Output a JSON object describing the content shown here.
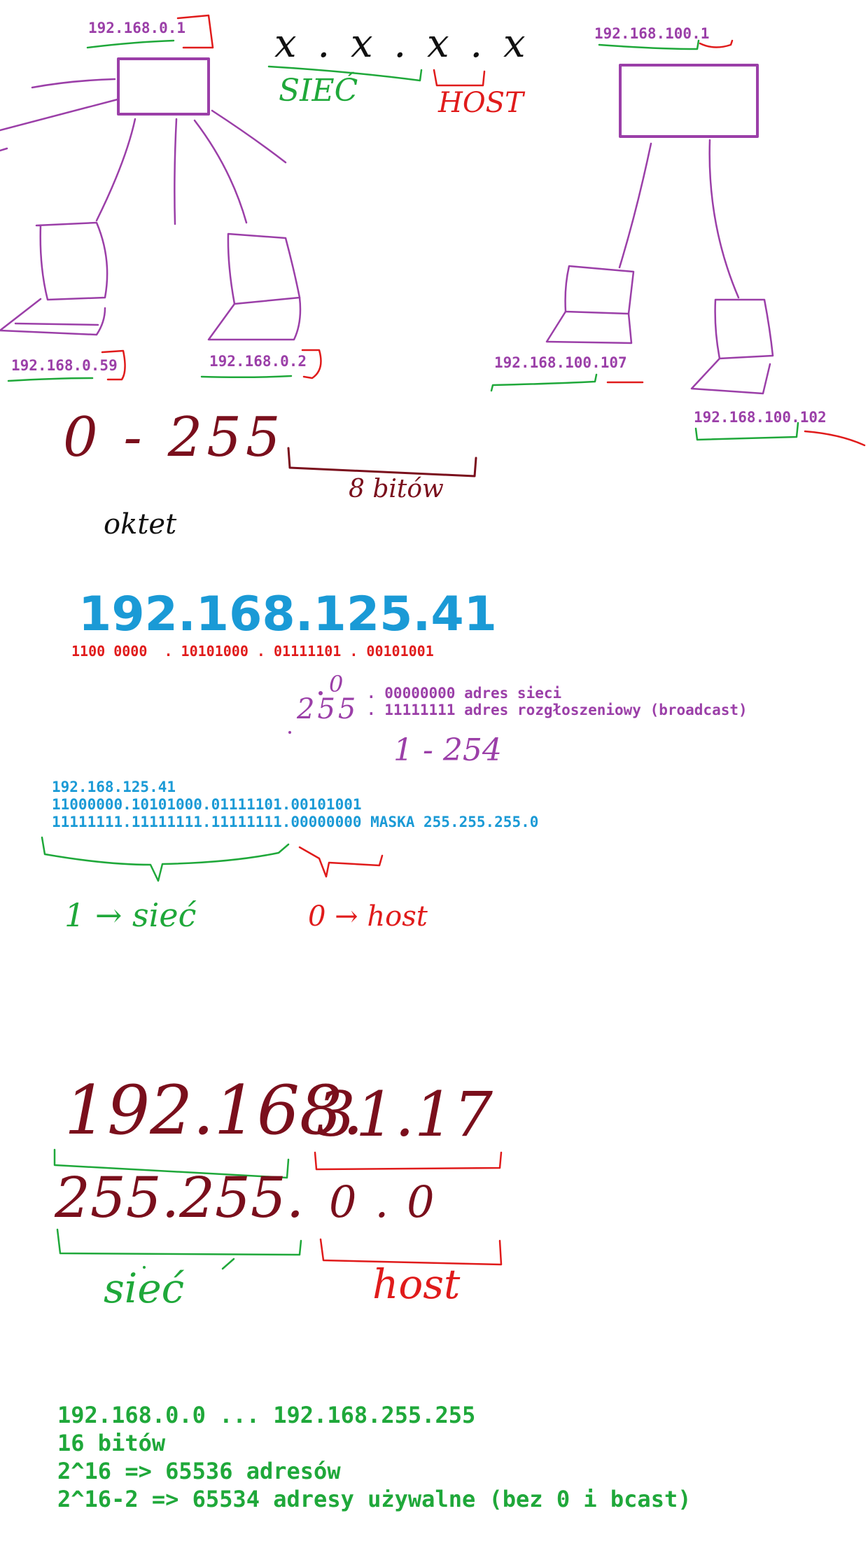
{
  "colors": {
    "purple": "#9b3fa8",
    "blue": "#1a9ad6",
    "red": "#e01b1b",
    "green": "#1fa83a",
    "dark_red": "#7a0f1c",
    "black": "#111111"
  },
  "network1": {
    "router_ip": "192.168.0.1",
    "laptop_left_ip": "192.168.0.59",
    "laptop_right_ip": "192.168.0.2"
  },
  "network2": {
    "router_ip": "192.168.100.1",
    "laptop_left_ip": "192.168.100.107",
    "laptop_right_ip": "192.168.100.102"
  },
  "pattern": {
    "notation": "x . x . x . x",
    "network_label": "SIEĆ",
    "host_label": "HOST"
  },
  "octet": {
    "range": "0 - 255",
    "bits_label": "8 bitów",
    "name": "oktet"
  },
  "example": {
    "ip": "192.168.125.41",
    "binary": "1100 0000  . 10101000 . 01111101 . 00101001",
    "zero_hand": "0",
    "max_hand": "255",
    "network_address_line": ". 00000000 adres sieci",
    "broadcast_line": ". 11111111 adres rozgłoszeniowy (broadcast)",
    "usable_range": "1 - 254"
  },
  "mask_calc": {
    "line1": "192.168.125.41",
    "line2": "11000000.10101000.01111101.00101001",
    "line3": "11111111.11111111.11111111.00000000 MASKA 255.255.255.0",
    "one_label": "1 → sieć",
    "zero_label": "0 → host"
  },
  "split_example": {
    "ip_network_part": "192.168.",
    "ip_host_part": "31.17",
    "mask_network_part": "255.255.",
    "mask_host_part": "0.0",
    "network_label": "sieć",
    "host_label": "host"
  },
  "summary": {
    "line1": "192.168.0.0 ... 192.168.255.255",
    "line2": "16 bitów",
    "line3": "2^16 => 65536 adresów",
    "line4": "2^16-2 => 65534 adresy używalne (bez 0 i bcast)"
  }
}
